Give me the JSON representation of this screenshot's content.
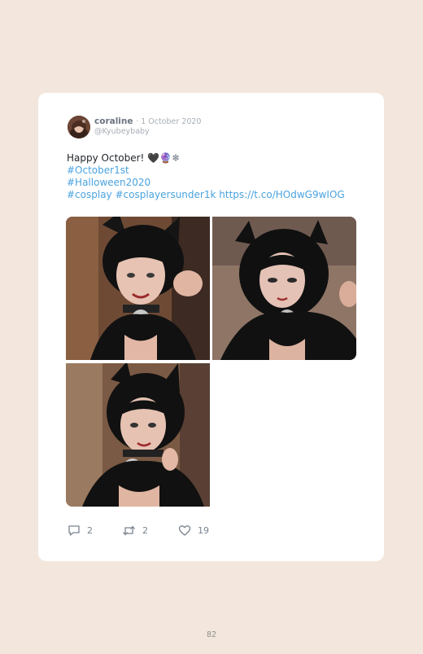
{
  "tweet": {
    "author_name": "coraline",
    "date": "· 1 October 2020",
    "handle": "@Kyubeybaby",
    "text_main": "Happy October! ",
    "emoji_heart": "🖤",
    "emoji_ball": "🔮",
    "emoji_snow": "❄",
    "hashtag_1": "#October1st",
    "hashtag_2": "#Halloween2020",
    "hashtag_3": "#cosplay",
    "hashtag_4": "#cosplayersunder1k",
    "link": "https://t.co/HOdwG9wIOG",
    "photos": [
      "cosplay-photo-1",
      "cosplay-photo-2",
      "cosplay-photo-3"
    ],
    "reply_count": "2",
    "retweet_count": "2",
    "like_count": "19"
  },
  "page": {
    "number": "82"
  },
  "colors": {
    "background": "#f3e7dd",
    "card": "#ffffff",
    "link": "#4aa3df",
    "muted": "#a7aeb6"
  }
}
